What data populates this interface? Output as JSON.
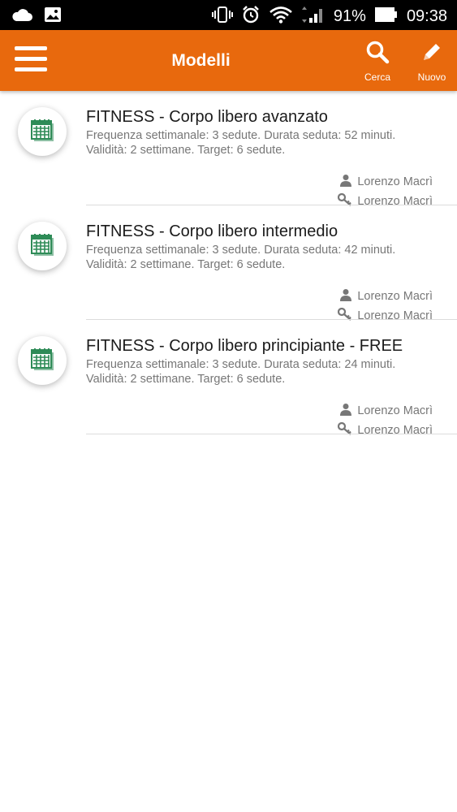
{
  "status_bar": {
    "battery": "91%",
    "time": "09:38"
  },
  "header": {
    "title": "Modelli",
    "search_label": "Cerca",
    "new_label": "Nuovo"
  },
  "colors": {
    "accent": "#e8690d",
    "icon_green": "#2e8b57"
  },
  "items": [
    {
      "title": "FITNESS - Corpo libero avanzato",
      "line1": "Frequenza settimanale: 3 sedute. Durata seduta: 52 minuti.",
      "line2": "Validità: 2 settimane. Target: 6 sedute.",
      "trainer": "Lorenzo Macrì",
      "owner": "Lorenzo Macrì"
    },
    {
      "title": "FITNESS - Corpo libero intermedio",
      "line1": "Frequenza settimanale: 3 sedute. Durata seduta: 42 minuti.",
      "line2": "Validità: 2 settimane. Target: 6 sedute.",
      "trainer": "Lorenzo Macrì",
      "owner": "Lorenzo Macrì"
    },
    {
      "title": "FITNESS - Corpo libero principiante - FREE",
      "line1": "Frequenza settimanale: 3 sedute. Durata seduta: 24 minuti.",
      "line2": "Validità: 2 settimane. Target: 6 sedute.",
      "trainer": "Lorenzo Macrì",
      "owner": "Lorenzo Macrì"
    }
  ]
}
